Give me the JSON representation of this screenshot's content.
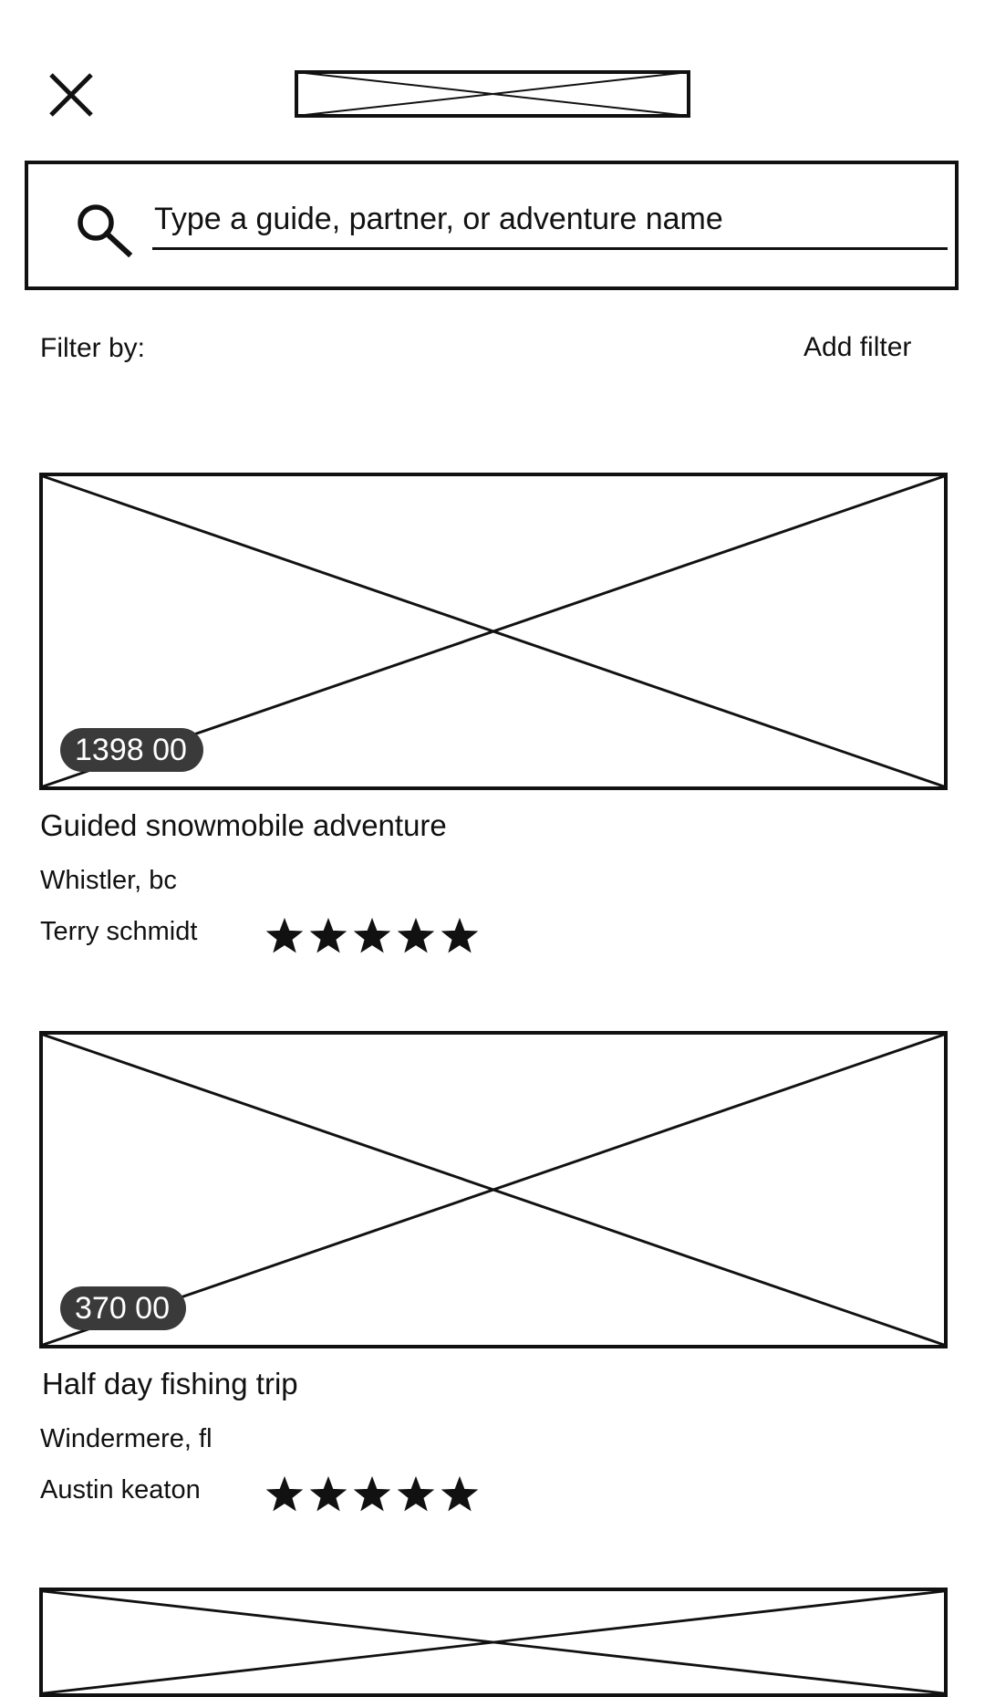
{
  "header": {
    "close_icon": "close-icon",
    "logo": "logo-placeholder-image"
  },
  "search": {
    "icon": "search-icon",
    "placeholder": "Type a guide, partner, or adventure name",
    "value": ""
  },
  "filters": {
    "label": "Filter by:",
    "add_label": "Add filter"
  },
  "listings": [
    {
      "price": "1398 00",
      "title": "Guided snowmobile adventure",
      "location": "Whistler, bc",
      "guide": "Terry schmidt",
      "rating": 5,
      "rating_max": 5
    },
    {
      "price": "370 00",
      "title": "Half day fishing trip",
      "location": "Windermere, fl",
      "guide": "Austin keaton",
      "rating": 5,
      "rating_max": 5
    }
  ],
  "colors": {
    "ink": "#111111",
    "price_pill_bg": "#3a3a3a",
    "price_pill_text": "#ffffff",
    "background": "#ffffff"
  }
}
